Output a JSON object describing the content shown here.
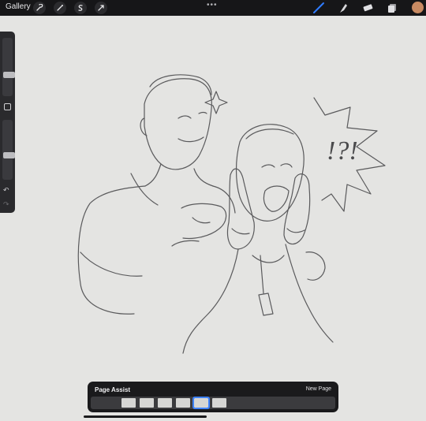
{
  "topbar": {
    "gallery_label": "Gallery",
    "left_tools": [
      "wrench-icon",
      "magic-wand-icon",
      "selection-icon",
      "transform-icon"
    ],
    "more_label": "•••",
    "right_tools": [
      "brush-icon",
      "smudge-icon",
      "eraser-icon",
      "layers-icon"
    ],
    "active_tool": "brush-icon",
    "accent_color": "#2f7bff",
    "current_color": "#c88a62"
  },
  "sidebar": {
    "brush_size_level": 0.35,
    "opacity_level": 0.4,
    "undo_icon": "undo-icon",
    "redo_icon": "redo-icon"
  },
  "canvas": {
    "annotation": "!?!",
    "paper_color": "#e4e4e2"
  },
  "page_assist": {
    "title": "Page Assist",
    "new_page_label": "New Page",
    "page_count": 6,
    "active_page": 5
  }
}
